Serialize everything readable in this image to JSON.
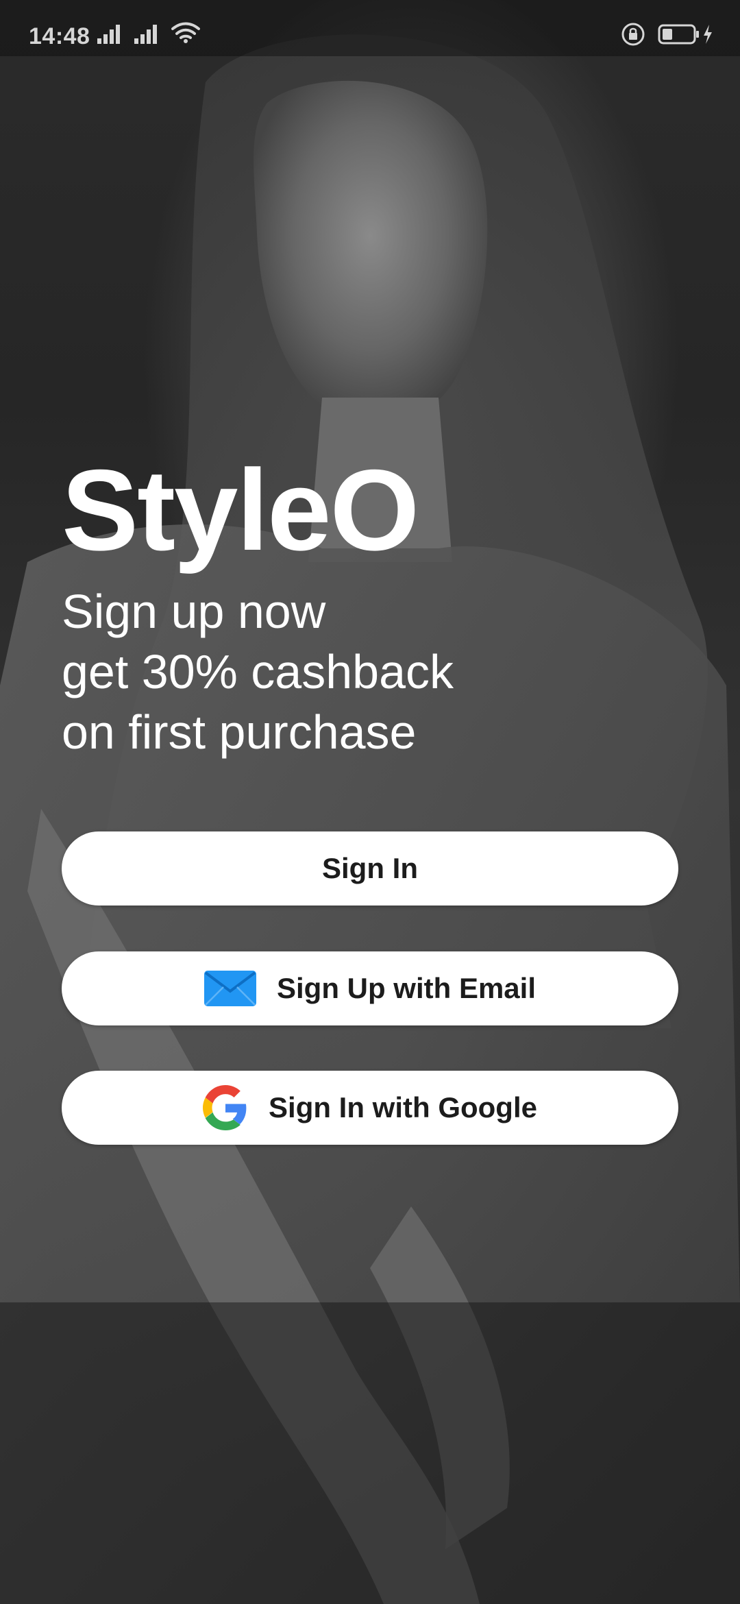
{
  "status_bar": {
    "time": "14:48",
    "icons": [
      "signal-icon",
      "signal-icon",
      "wifi-icon",
      "rotation-lock-icon",
      "battery-icon",
      "charging-icon"
    ]
  },
  "hero": {
    "brand": "StyleO",
    "tagline": [
      "Sign up now",
      "get 30% cashback",
      "on first purchase"
    ]
  },
  "buttons": {
    "sign_in": "Sign In",
    "sign_up_email": "Sign Up with Email",
    "sign_in_google": "Sign In with Google"
  },
  "colors": {
    "button_bg": "#FFFFFF",
    "button_text": "#1C1C1C",
    "email_icon": "#2196F3",
    "google_blue": "#4285F4",
    "google_red": "#EA4335",
    "google_yellow": "#FBBC05",
    "google_green": "#34A853"
  }
}
